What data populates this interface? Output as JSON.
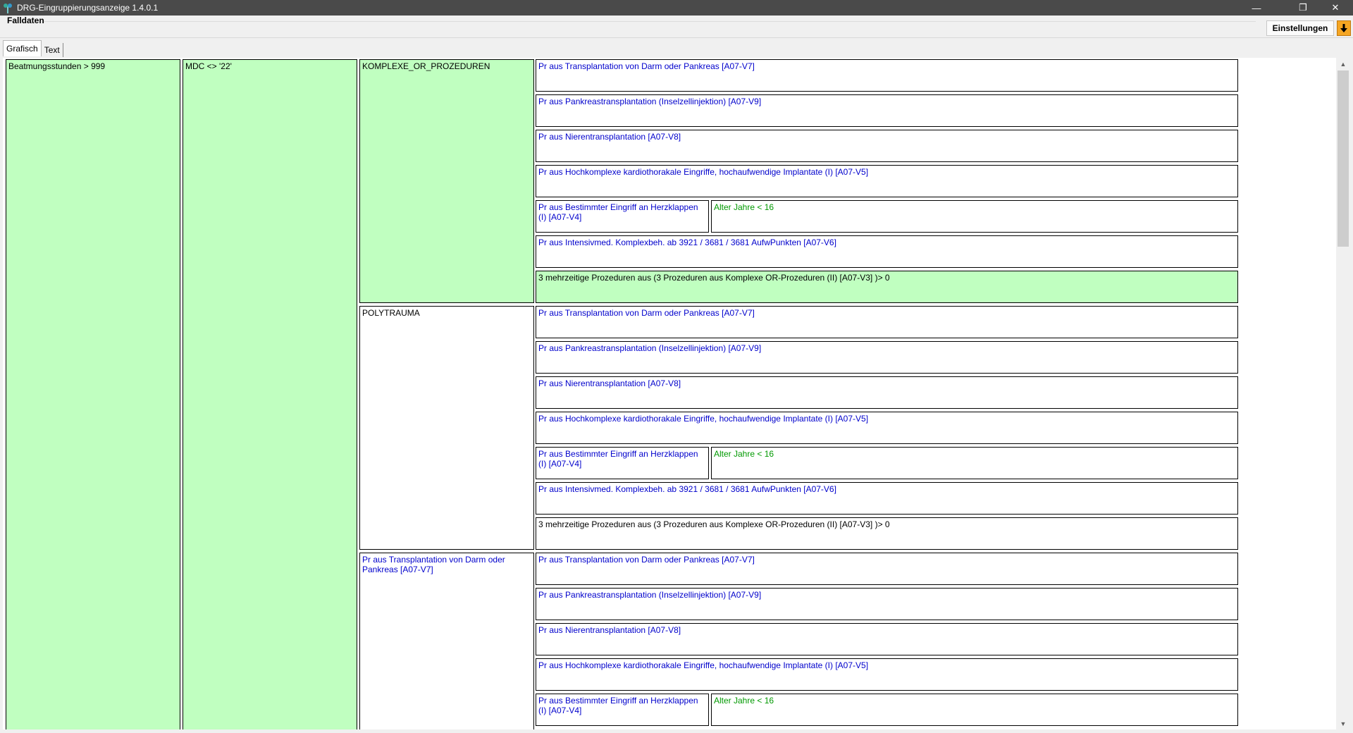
{
  "window": {
    "title": "DRG-Eingruppierungsanzeige 1.4.0.1"
  },
  "header": {
    "group_label": "Falldaten",
    "settings_label": "Einstellungen"
  },
  "tabs": [
    {
      "label": "Grafisch",
      "active": true
    },
    {
      "label": "Text",
      "active": false
    }
  ],
  "colors": {
    "green": "#c0ffc0",
    "blue_text": "#0000cc",
    "green_text": "#009900",
    "accent": "#f5a623"
  },
  "tree": {
    "col1": "Beatmungsstunden > 999",
    "col2": "MDC <> '22'",
    "col3": {
      "komplexe": "KOMPLEXE_OR_PROZEDUREN",
      "polytrauma": "POLYTRAUMA",
      "transplantation": "Pr aus Transplantation von Darm oder Pankreas [A07-V7]"
    },
    "leaves": {
      "darm_pankreas": "Pr aus Transplantation von Darm oder Pankreas [A07-V7]",
      "pankreas": "Pr aus Pankreastransplantation (Inselzellinjektion) [A07-V9]",
      "niere": "Pr aus Nierentransplantation [A07-V8]",
      "hochkomplex": "Pr aus Hochkomplexe kardiothorakale Eingriffe, hochaufwendige Implantate (I) [A07-V5]",
      "herzklappen": "Pr aus Bestimmter Eingriff an Herzklappen (I) [A07-V4]",
      "alter": "Alter Jahre < 16",
      "intensiv": "Pr aus Intensivmed. Komplexbeh. ab 3921 / 3681 / 3681 AufwPunkten [A07-V6]",
      "mehrzeitig": "3 mehrzeitige Prozeduren aus (3 Prozeduren aus Komplexe OR-Prozeduren (II) [A07-V3] )> 0"
    }
  }
}
